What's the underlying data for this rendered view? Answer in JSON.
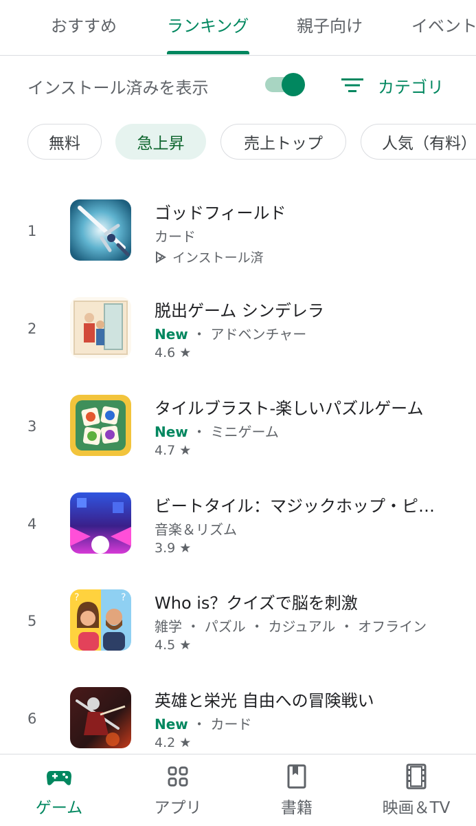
{
  "tabs": [
    "おすすめ",
    "ランキング",
    "親子向け",
    "イベント"
  ],
  "active_tab": "ランキング",
  "installed_toggle": {
    "label": "インストール済みを表示",
    "on": true
  },
  "category_button": {
    "label": "カテゴリ"
  },
  "chips": [
    "無料",
    "急上昇",
    "売上トップ",
    "人気（有料）"
  ],
  "selected_chip": "急上昇",
  "apps": [
    {
      "rank": "1",
      "title": "ゴッドフィールド",
      "new": "",
      "subtitle": "カード",
      "status": "インストール済",
      "icon": "sword-icon"
    },
    {
      "rank": "2",
      "title": "脱出ゲーム シンデレラ",
      "new": "New",
      "subtitle": "・ アドベンチャー",
      "rating": "4.6",
      "icon": "storybook-icon"
    },
    {
      "rank": "3",
      "title": "タイルブラスト-楽しいパズルゲーム",
      "new": "New",
      "subtitle": "・ ミニゲーム",
      "rating": "4.7",
      "icon": "fruit-tiles-icon"
    },
    {
      "rank": "4",
      "title": "ビートタイル：マジックホップ・ピ…",
      "new": "",
      "subtitle": "音楽＆リズム",
      "rating": "3.9",
      "icon": "neon-ball-icon"
    },
    {
      "rank": "5",
      "title": "Who is？クイズで脳を刺激",
      "new": "",
      "subtitle": "雑学 ・ パズル ・ カジュアル ・ オフライン",
      "rating": "4.5",
      "icon": "quiz-couple-icon"
    },
    {
      "rank": "6",
      "title": "英雄と栄光 自由への冒険戦い",
      "new": "New",
      "subtitle": "・ カード",
      "rating": "4.2",
      "icon": "warrior-icon"
    }
  ],
  "bottom_nav": [
    "ゲーム",
    "アプリ",
    "書籍",
    "映画＆TV"
  ],
  "active_nav": "ゲーム",
  "colors": {
    "accent": "#01875f",
    "chip_selected_bg": "#e6f3ef",
    "text_secondary": "#5f6368"
  }
}
